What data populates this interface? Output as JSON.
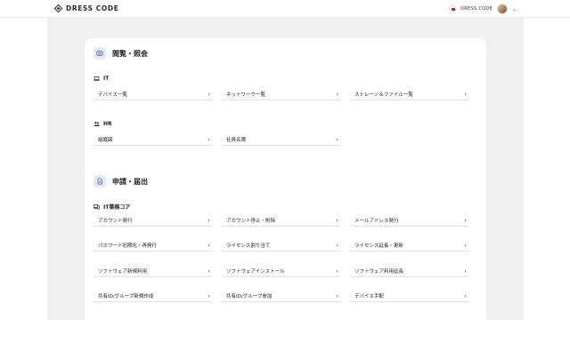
{
  "header": {
    "logo_text": "DRESS CODE",
    "user_name": "DRESS CODE",
    "flag": "jp-flag-icon",
    "menu_icon": "chevron-down-icon"
  },
  "sections": [
    {
      "title": "閲覧・照会",
      "icon": "view-icon",
      "groups": [
        {
          "label": "IT",
          "icon": "laptop-icon",
          "items": [
            "デバイス一覧",
            "ネットワーク一覧",
            "ストレージ＆ファイル一覧"
          ]
        },
        {
          "label": "HR",
          "icon": "people-icon",
          "items": [
            "組織図",
            "社員名簿"
          ]
        }
      ]
    },
    {
      "title": "申請・届出",
      "icon": "document-icon",
      "groups": [
        {
          "label": "IT業務コア",
          "icon": "devices-icon",
          "items": [
            "アカウント発行",
            "アカウント停止・削除",
            "メールアドレス発行",
            "パスワード初期化・再発行",
            "ライセンス割り当て",
            "ライセンス延長・更新",
            "ソフトウェア新規利用",
            "ソフトウェアインストール",
            "ソフトウェア利用延長",
            "共有ID/グループ新規作成",
            "共有ID/グループ参加",
            "デバイス手配"
          ]
        }
      ]
    }
  ],
  "arrow_glyph": "›",
  "colors": {
    "page_bg": "#f0f0f0",
    "card_bg": "#ffffff",
    "icon_bg": "#e6ebf7",
    "icon_fg": "#4a5fa8",
    "divider": "#e2e2e2"
  }
}
